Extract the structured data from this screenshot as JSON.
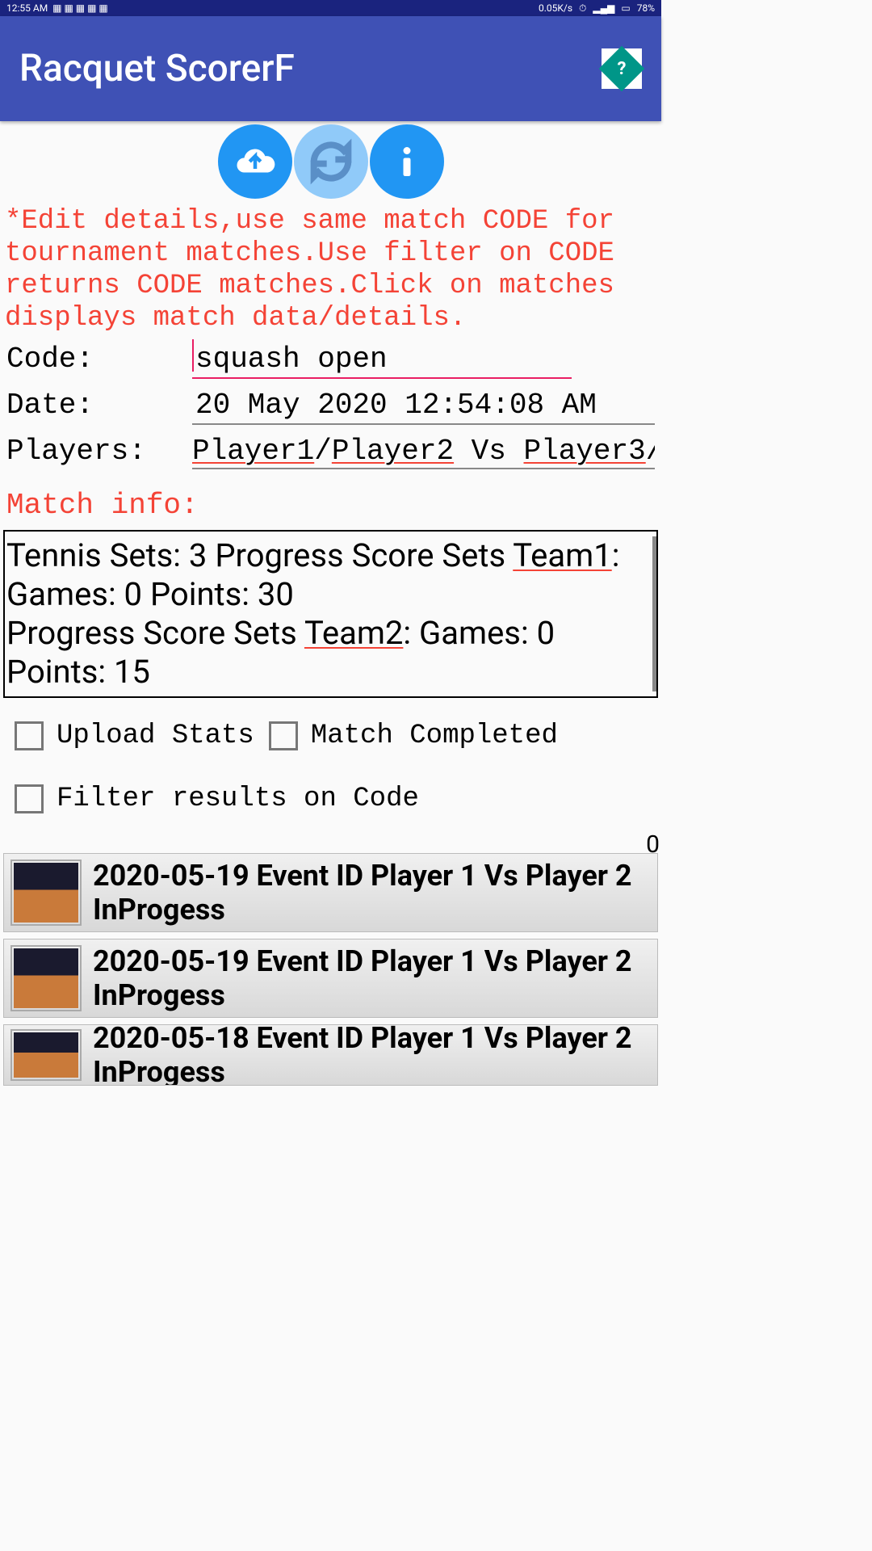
{
  "status": {
    "time": "12:55 AM",
    "net": "0.05K/s",
    "battery": "78%"
  },
  "app": {
    "title": "Racquet ScorerF",
    "help_glyph": "?"
  },
  "instructions": "*Edit details,use same match CODE for tournament matches.Use filter on CODE returns CODE matches.Click on matches displays match data/details.",
  "form": {
    "code_label": "Code:",
    "code_value": "squash open",
    "date_label": "Date:",
    "date_value": "20 May 2020 12:54:08 AM",
    "players_label": "Players:",
    "players_p1": "Player1",
    "players_p2": "Player2",
    "players_vs": " Vs ",
    "players_p3": "Player3",
    "players_tail": "/P"
  },
  "match_info": {
    "label": "Match info:",
    "text_pre": "Tennis  Sets: 3 Progress Score Sets ",
    "team1": "Team1",
    "mid1": ":  Games: 0 Points: 30",
    "mid2a": "Progress Score Sets ",
    "team2": "Team2",
    "mid2b": ":  Games: 0 Points: 15"
  },
  "checks": {
    "upload": "Upload Stats",
    "completed": "Match Completed",
    "filter": "Filter results on Code"
  },
  "list_count": "0",
  "matches": [
    {
      "text": "2020-05-19 Event ID Player 1 Vs Player 2 InProgess"
    },
    {
      "text": "2020-05-19 Event ID Player 1 Vs Player 2 InProgess"
    },
    {
      "text": "2020-05-18 Event ID Player 1 Vs Player 2 InProgess"
    }
  ]
}
